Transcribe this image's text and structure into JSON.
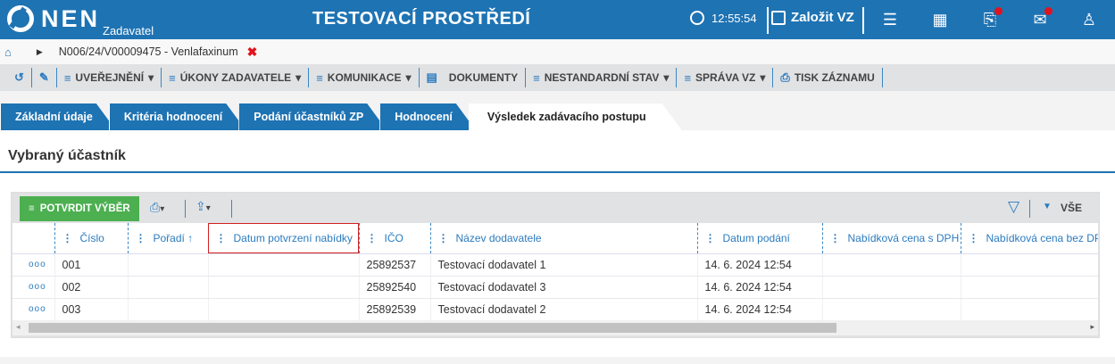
{
  "header": {
    "logo_text": "NEN",
    "logo_sub": "Zadavatel",
    "env_title": "TESTOVACÍ PROSTŘEDÍ",
    "time": "12:55:54",
    "create_label": "Založit VZ",
    "colors": {
      "brand": "#1e73b3",
      "badge": "#e0141e"
    }
  },
  "breadcrumb": {
    "item": "N006/24/V00009475 - Venlafaxinum"
  },
  "toolbar": {
    "items": [
      "UVEŘEJNĚNÍ",
      "ÚKONY ZADAVATELE",
      "KOMUNIKACE",
      "DOKUMENTY",
      "NESTANDARDNÍ STAV",
      "SPRÁVA VZ",
      "TISK ZÁZNAMU"
    ]
  },
  "tabs": [
    "Základní údaje",
    "Kritéria hodnocení",
    "Podání účastníků ZP",
    "Hodnocení",
    "Výsledek zadávacího postupu"
  ],
  "panel": {
    "title": "Vybraný účastník"
  },
  "grid": {
    "confirm_label": "POTVRDIT VÝBĚR",
    "filter_label": "VŠE",
    "columns": [
      "Číslo",
      "Pořadí ↑",
      "Datum potvrzení nabídky",
      "IČO",
      "Název dodavatele",
      "Datum podání",
      "Nabídková cena s DPH",
      "Nabídková cena bez DPH"
    ],
    "rows": [
      [
        "001",
        "",
        "",
        "25892537",
        "Testovací dodavatel 1",
        "14. 6. 2024 12:54",
        "",
        ""
      ],
      [
        "002",
        "",
        "",
        "25892540",
        "Testovací dodavatel 3",
        "14. 6. 2024 12:54",
        "",
        ""
      ],
      [
        "003",
        "",
        "",
        "25892539",
        "Testovací dodavatel 2",
        "14. 6. 2024 12:54",
        "",
        ""
      ]
    ],
    "row_menu": "ooo"
  }
}
